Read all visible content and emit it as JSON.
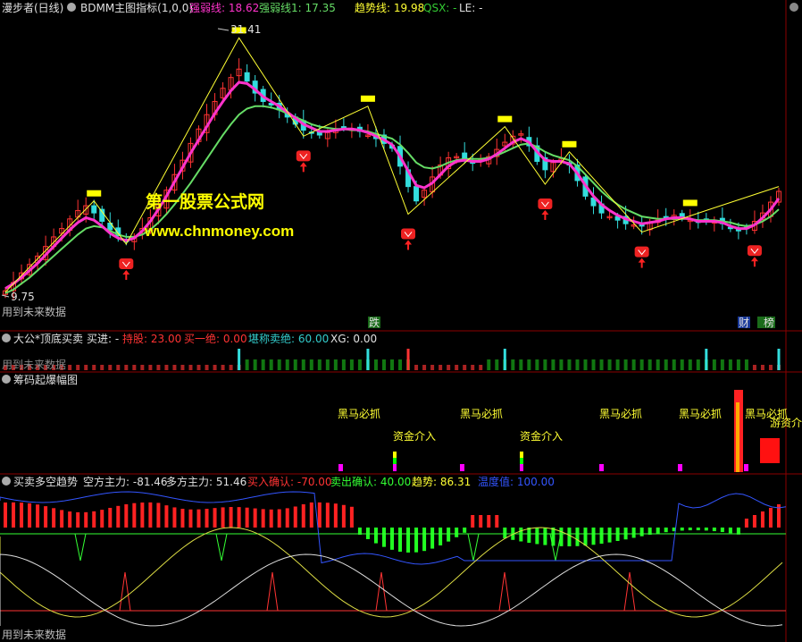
{
  "main_panel": {
    "title_items": [
      {
        "text": "漫步者(日线)",
        "color": "#e0e0e0"
      },
      {
        "text": "BDMM主图指标(1,0,0)",
        "color": "#e0e0e0"
      },
      {
        "text": "强弱线: 18.62",
        "color": "#ff33cc"
      },
      {
        "text": "强弱线1: 17.35",
        "color": "#66dd66"
      },
      {
        "text": "趋势线: 19.98",
        "color": "#ffff33"
      },
      {
        "text": "QSX: -",
        "color": "#33cc33"
      },
      {
        "text": "LE: -",
        "color": "#e0e0e0"
      }
    ],
    "high_label": "31.41",
    "low_label": "9.75",
    "watermark_line1": "第一股票公式网",
    "watermark_line2": "www.chnmoney.com",
    "future_text": "用到未来数据",
    "tag_die": "跌",
    "tag_cai": "财",
    "tag_bang": "榜"
  },
  "panel2": {
    "title_items": [
      {
        "text": "大公*顶底买卖",
        "color": "#e0e0e0"
      },
      {
        "text": "买进: -",
        "color": "#e0e0e0"
      },
      {
        "text": "持股: 23.00",
        "color": "#ff3333"
      },
      {
        "text": "买一绝: 0.00",
        "color": "#ff3333"
      },
      {
        "text": "堪称卖绝: 60.00",
        "color": "#33cccc"
      },
      {
        "text": "XG: 0.00",
        "color": "#e0e0e0"
      }
    ],
    "future_text": "用到未来数据"
  },
  "panel3": {
    "title": "筹码起爆幅图",
    "black_horse": "黑马必抓",
    "funds_in": "资金介入",
    "funds_in_short": "游资介入",
    "black_horse_short": "黑马必"
  },
  "panel4": {
    "title_items": [
      {
        "text": "买卖多空趋势",
        "color": "#e0e0e0"
      },
      {
        "text": "空方主力: -81.46",
        "color": "#e0e0e0"
      },
      {
        "text": "多方主力: 51.46",
        "color": "#e0e0e0"
      },
      {
        "text": "买入确认: -70.00",
        "color": "#ff3333"
      },
      {
        "text": "卖出确认: 40.00",
        "color": "#33ff33"
      },
      {
        "text": "趋势: 86.31",
        "color": "#ffff33"
      },
      {
        "text": "温度值: 100.00",
        "color": "#3355ff"
      }
    ],
    "future_text": "用到未来数据"
  },
  "chart_data": {
    "type": "candlestick",
    "colors": {
      "up": "#ff3333",
      "down": "#33dddd",
      "strong_line": "#ff33cc",
      "strong_line1": "#66dd66",
      "trend_line": "#ffff33"
    },
    "price_range": [
      9.75,
      31.41
    ],
    "close": [
      10.1,
      10.8,
      11.6,
      12.3,
      13.0,
      13.8,
      14.6,
      15.3,
      16.1,
      16.8,
      17.2,
      16.6,
      15.9,
      15.2,
      14.7,
      14.2,
      14.6,
      15.3,
      16.2,
      17.3,
      18.5,
      19.8,
      21.0,
      22.4,
      23.6,
      24.8,
      25.9,
      27.0,
      27.9,
      28.6,
      27.6,
      26.6,
      25.9,
      25.6,
      25.2,
      24.6,
      24.0,
      23.5,
      23.3,
      23.1,
      23.3,
      23.5,
      23.7,
      23.6,
      23.4,
      23.1,
      22.8,
      22.4,
      22.0,
      20.5,
      18.8,
      17.6,
      18.5,
      19.6,
      20.6,
      21.2,
      21.3,
      21.0,
      20.8,
      21.0,
      21.3,
      21.9,
      22.5,
      23.0,
      23.2,
      22.2,
      20.9,
      20.2,
      20.8,
      21.1,
      20.6,
      19.3,
      18.0,
      17.2,
      16.6,
      16.3,
      16.0,
      15.7,
      15.6,
      15.5,
      15.8,
      16.0,
      16.2,
      16.4,
      16.2,
      16.0,
      15.8,
      15.9,
      16.0,
      15.7,
      15.3,
      15.1,
      15.3,
      15.9,
      16.6,
      17.5,
      18.4
    ],
    "strong_line": [
      10.3,
      10.7,
      11.2,
      11.8,
      12.4,
      13.1,
      13.8,
      14.5,
      15.2,
      15.8,
      16.2,
      16.0,
      15.5,
      14.9,
      14.5,
      14.3,
      14.5,
      15.1,
      15.9,
      16.9,
      18.0,
      19.2,
      20.4,
      21.6,
      22.7,
      23.8,
      24.9,
      25.9,
      26.8,
      27.5,
      27.4,
      26.9,
      26.3,
      25.9,
      25.5,
      25.0,
      24.5,
      24.0,
      23.7,
      23.4,
      23.4,
      23.5,
      23.6,
      23.6,
      23.5,
      23.3,
      23.0,
      22.7,
      22.3,
      21.3,
      20.1,
      18.9,
      18.7,
      19.1,
      19.8,
      20.5,
      20.9,
      21.0,
      20.9,
      20.9,
      21.1,
      21.5,
      22.0,
      22.5,
      22.8,
      22.5,
      21.7,
      21.0,
      20.9,
      20.9,
      20.7,
      19.9,
      18.9,
      18.0,
      17.3,
      16.8,
      16.4,
      16.1,
      15.9,
      15.7,
      15.8,
      15.9,
      16.1,
      16.2,
      16.2,
      16.1,
      15.9,
      15.9,
      15.9,
      15.8,
      15.5,
      15.3,
      15.3,
      15.6,
      16.2,
      16.9,
      17.8
    ],
    "strong_line1": [
      9.9,
      10.2,
      10.7,
      11.2,
      11.8,
      12.4,
      13.0,
      13.6,
      14.2,
      14.8,
      15.3,
      15.5,
      15.4,
      15.1,
      14.8,
      14.6,
      14.6,
      14.8,
      15.2,
      15.8,
      16.5,
      17.3,
      18.2,
      19.1,
      20.1,
      21.1,
      22.1,
      23.1,
      24.0,
      24.8,
      25.3,
      25.5,
      25.5,
      25.4,
      25.2,
      24.9,
      24.6,
      24.3,
      24.0,
      23.8,
      23.7,
      23.6,
      23.6,
      23.5,
      23.5,
      23.4,
      23.2,
      23.0,
      22.8,
      22.3,
      21.6,
      20.8,
      20.4,
      20.3,
      20.5,
      20.8,
      21.0,
      21.1,
      21.1,
      21.1,
      21.2,
      21.4,
      21.7,
      22.0,
      22.3,
      22.4,
      22.1,
      21.7,
      21.4,
      21.2,
      21.0,
      20.5,
      19.8,
      19.1,
      18.4,
      17.8,
      17.3,
      16.9,
      16.6,
      16.3,
      16.2,
      16.1,
      16.1,
      16.1,
      16.1,
      16.1,
      16.0,
      16.0,
      16.0,
      15.9,
      15.8,
      15.6,
      15.5,
      15.6,
      15.9,
      16.3,
      16.9
    ],
    "annotations": {
      "high": 31.41,
      "low": 9.75
    }
  }
}
